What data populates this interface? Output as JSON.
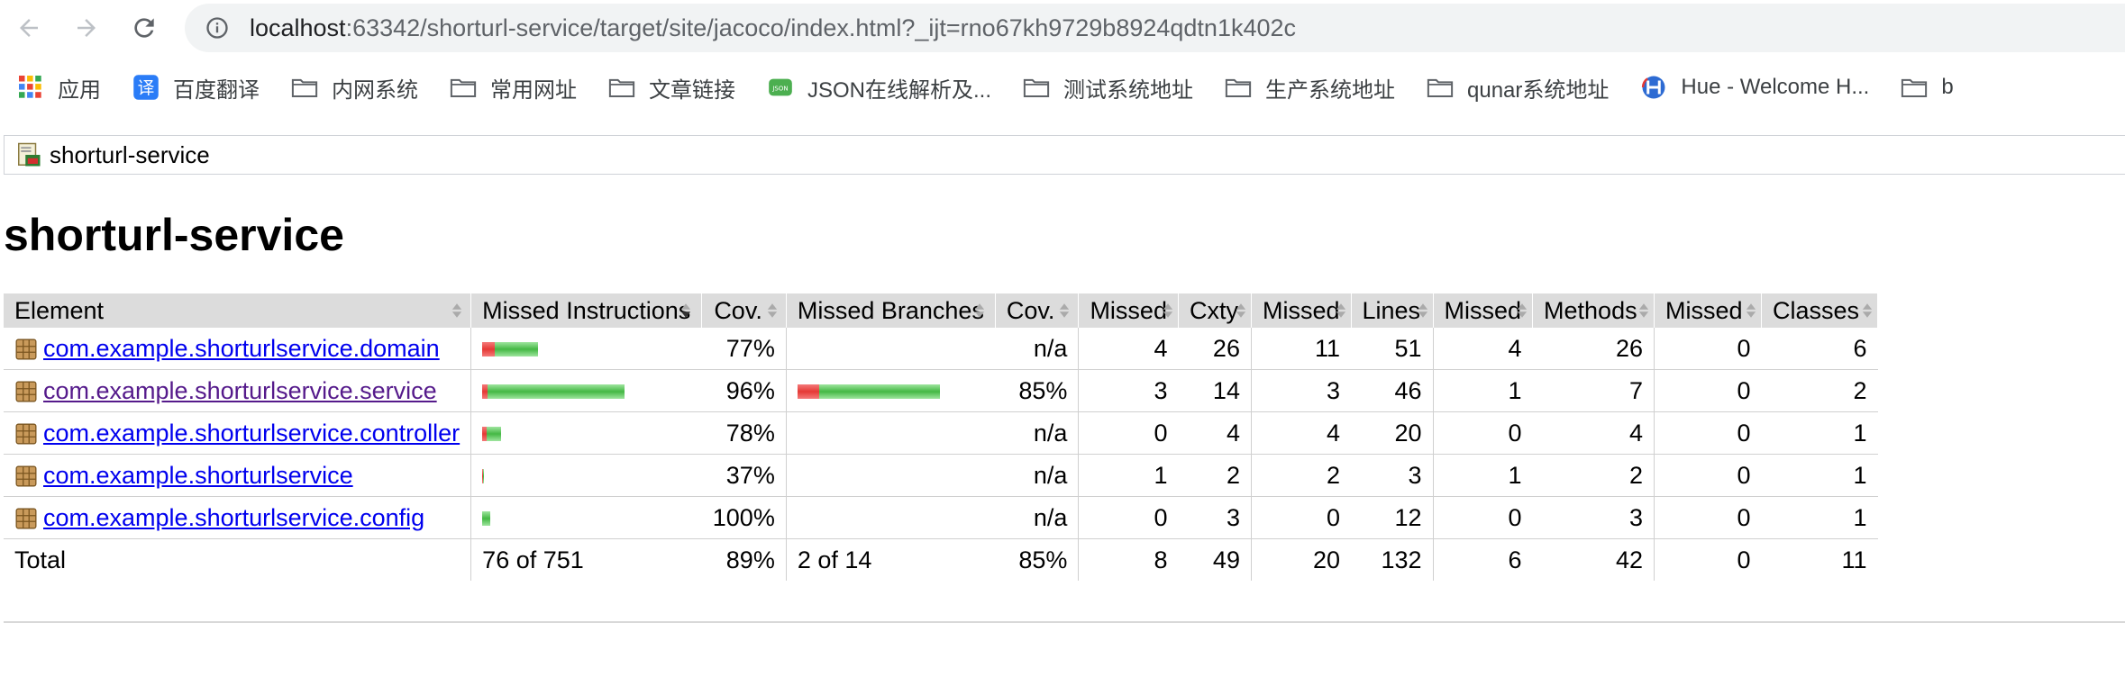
{
  "browser": {
    "url_host": "localhost",
    "url_rest": ":63342/shorturl-service/target/site/jacoco/index.html?_ijt=rno67kh9729b8924qdtn1k402c"
  },
  "bookmarks": [
    {
      "label": "应用",
      "icon": "apps-grid-icon"
    },
    {
      "label": "百度翻译",
      "icon": "baidu-translate-icon"
    },
    {
      "label": "内网系统",
      "icon": "folder-icon"
    },
    {
      "label": "常用网址",
      "icon": "folder-icon"
    },
    {
      "label": "文章链接",
      "icon": "folder-icon"
    },
    {
      "label": "JSON在线解析及...",
      "icon": "json-icon"
    },
    {
      "label": "测试系统地址",
      "icon": "folder-icon"
    },
    {
      "label": "生产系统地址",
      "icon": "folder-icon"
    },
    {
      "label": "qunar系统地址",
      "icon": "folder-icon"
    },
    {
      "label": "Hue - Welcome H...",
      "icon": "hue-icon"
    },
    {
      "label": "b",
      "icon": "folder-icon"
    }
  ],
  "page": {
    "breadcrumb": "shorturl-service",
    "title": "shorturl-service"
  },
  "table": {
    "headers": [
      "Element",
      "Missed Instructions",
      "Cov.",
      "Missed Branches",
      "Cov.",
      "Missed",
      "Cxty",
      "Missed",
      "Lines",
      "Missed",
      "Methods",
      "Missed",
      "Classes"
    ],
    "rows": [
      {
        "element": "com.example.shorturlservice.domain",
        "instr_missed_frac": 0.23,
        "instr_bar_scale": 0.39,
        "instr_cov": "77%",
        "branch_bar": null,
        "branch_missed_frac": 0,
        "branch_cov": "n/a",
        "cxty_missed": "4",
        "cxty": "26",
        "lines_missed": "11",
        "lines": "51",
        "methods_missed": "4",
        "methods": "26",
        "classes_missed": "0",
        "classes": "6",
        "visited": false
      },
      {
        "element": "com.example.shorturlservice.service",
        "instr_missed_frac": 0.04,
        "instr_bar_scale": 1.0,
        "instr_cov": "96%",
        "branch_bar": 1.0,
        "branch_missed_frac": 0.15,
        "branch_cov": "85%",
        "cxty_missed": "3",
        "cxty": "14",
        "lines_missed": "3",
        "lines": "46",
        "methods_missed": "1",
        "methods": "7",
        "classes_missed": "0",
        "classes": "2",
        "visited": true
      },
      {
        "element": "com.example.shorturlservice.controller",
        "instr_missed_frac": 0.22,
        "instr_bar_scale": 0.13,
        "instr_cov": "78%",
        "branch_bar": null,
        "branch_missed_frac": 0,
        "branch_cov": "n/a",
        "cxty_missed": "0",
        "cxty": "4",
        "lines_missed": "4",
        "lines": "20",
        "methods_missed": "0",
        "methods": "4",
        "classes_missed": "0",
        "classes": "1",
        "visited": false
      },
      {
        "element": "com.example.shorturlservice",
        "instr_missed_frac": 0.63,
        "instr_bar_scale": 0.01,
        "instr_cov": "37%",
        "branch_bar": null,
        "branch_missed_frac": 0,
        "branch_cov": "n/a",
        "cxty_missed": "1",
        "cxty": "2",
        "lines_missed": "2",
        "lines": "3",
        "methods_missed": "1",
        "methods": "2",
        "classes_missed": "0",
        "classes": "1",
        "visited": false
      },
      {
        "element": "com.example.shorturlservice.config",
        "instr_missed_frac": 0.0,
        "instr_bar_scale": 0.06,
        "instr_cov": "100%",
        "branch_bar": null,
        "branch_missed_frac": 0,
        "branch_cov": "n/a",
        "cxty_missed": "0",
        "cxty": "3",
        "lines_missed": "0",
        "lines": "12",
        "methods_missed": "0",
        "methods": "3",
        "classes_missed": "0",
        "classes": "1",
        "visited": false
      }
    ],
    "total": {
      "label": "Total",
      "instr": "76 of 751",
      "instr_cov": "89%",
      "branch": "2 of 14",
      "branch_cov": "85%",
      "cxty_missed": "8",
      "cxty": "49",
      "lines_missed": "20",
      "lines": "132",
      "methods_missed": "6",
      "methods": "42",
      "classes_missed": "0",
      "classes": "11"
    }
  }
}
